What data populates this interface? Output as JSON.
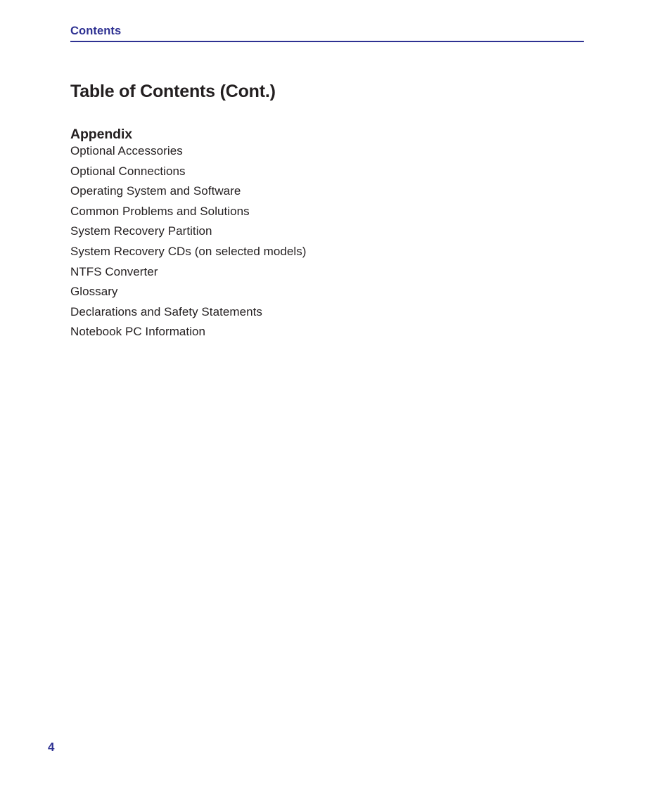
{
  "document": {
    "running_head": "Contents",
    "title": "Table of Contents (Cont.)",
    "page_number": "4"
  },
  "colors": {
    "accent": "#2E3192",
    "body_text": "#231F20",
    "page_background": "#FFFFFF"
  },
  "sections": [
    {
      "heading": "Appendix",
      "entries": [
        {
          "label": "Optional Accessories"
        },
        {
          "label": "Optional Connections"
        },
        {
          "label": "Operating System and Software"
        },
        {
          "label": "Common Problems and Solutions"
        },
        {
          "label": "System Recovery Partition"
        },
        {
          "label": "System Recovery CDs (on selected models)"
        },
        {
          "label": "NTFS Converter"
        },
        {
          "label": "Glossary"
        },
        {
          "label": "Declarations and Safety Statements"
        },
        {
          "label": "Notebook PC Information"
        }
      ]
    }
  ]
}
